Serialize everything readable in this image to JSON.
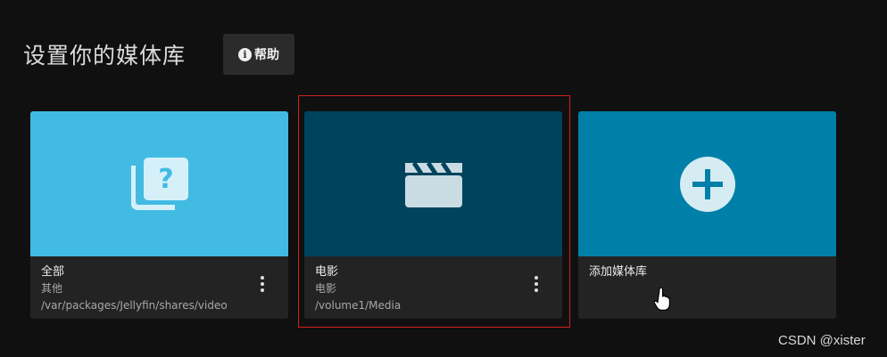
{
  "header": {
    "title": "设置你的媒体库",
    "help_label": "帮助",
    "help_icon": "info-icon"
  },
  "libraries": [
    {
      "name": "全部",
      "type": "其他",
      "path": "/var/packages/Jellyfin/shares/video",
      "icon": "unknown-collection-icon",
      "color": "#42bbe3"
    },
    {
      "name": "电影",
      "type": "电影",
      "path": "/volume1/Media",
      "icon": "clapperboard-icon",
      "color": "#00435c"
    }
  ],
  "add_library": {
    "label": "添加媒体库",
    "icon": "add-circle-icon",
    "color": "#0080a8"
  },
  "accent": {
    "selection_border": "#d32020"
  },
  "watermark": "CSDN @xister"
}
